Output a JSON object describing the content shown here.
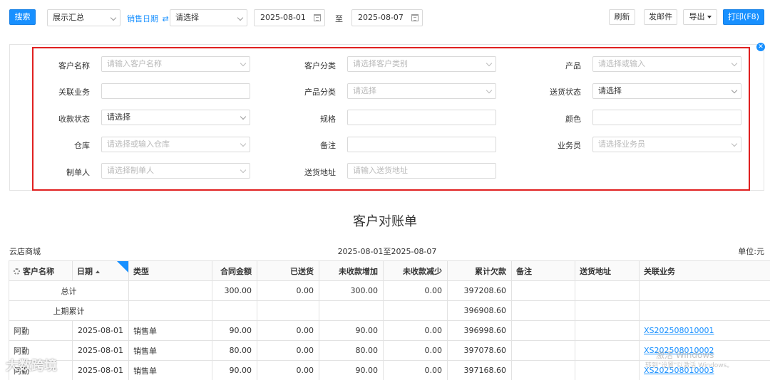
{
  "toolbar": {
    "search_label": "搜索",
    "summary_select": "展示汇总",
    "date_type_label": "销售日期",
    "date_type_select": "请选择",
    "date_start": "2025-08-01",
    "date_to_label": "至",
    "date_end": "2025-08-07",
    "refresh_label": "刷新",
    "email_label": "发邮件",
    "export_label": "导出",
    "print_label": "打印(F8)"
  },
  "filters": {
    "customer_name": {
      "label": "客户名称",
      "placeholder": "请输入客户名称"
    },
    "customer_category": {
      "label": "客户分类",
      "placeholder": "请选择客户类别"
    },
    "product": {
      "label": "产品",
      "placeholder": "请选择或输入"
    },
    "related_business": {
      "label": "关联业务",
      "value": ""
    },
    "product_category": {
      "label": "产品分类",
      "placeholder": "请选择"
    },
    "delivery_status": {
      "label": "送货状态",
      "value": "请选择"
    },
    "payment_status": {
      "label": "收款状态",
      "value": "请选择"
    },
    "spec": {
      "label": "规格",
      "value": ""
    },
    "color": {
      "label": "颜色",
      "value": ""
    },
    "warehouse": {
      "label": "仓库",
      "placeholder": "请选择或输入仓库"
    },
    "remark": {
      "label": "备注",
      "value": ""
    },
    "salesperson": {
      "label": "业务员",
      "placeholder": "请选择业务员"
    },
    "creator": {
      "label": "制单人",
      "placeholder": "请选择制单人"
    },
    "delivery_address": {
      "label": "送货地址",
      "placeholder": "请输入送货地址"
    }
  },
  "report": {
    "title": "客户对账单",
    "company": "云店商城",
    "period": "2025-08-01至2025-08-07",
    "unit": "单位:元",
    "headers": [
      "客户名称",
      "日期",
      "类型",
      "合同金额",
      "已送货",
      "未收款增加",
      "未收款减少",
      "累计欠款",
      "备注",
      "送货地址",
      "关联业务"
    ],
    "total_row": {
      "label": "总计",
      "contract": "300.00",
      "delivered": "0.00",
      "increase": "300.00",
      "decrease": "0.00",
      "balance": "397208.60"
    },
    "prior_row": {
      "label": "上期累计",
      "balance": "396908.60"
    },
    "rows": [
      {
        "customer": "阿勤",
        "date": "2025-08-01",
        "type": "销售单",
        "contract": "90.00",
        "delivered": "0.00",
        "increase": "90.00",
        "decrease": "0.00",
        "balance": "396998.60",
        "remark": "",
        "address": "",
        "business": "XS202508010001"
      },
      {
        "customer": "阿勤",
        "date": "2025-08-01",
        "type": "销售单",
        "contract": "80.00",
        "delivered": "0.00",
        "increase": "80.00",
        "decrease": "0.00",
        "balance": "397078.60",
        "remark": "",
        "address": "",
        "business": "XS202508010002"
      },
      {
        "customer": "阿勤",
        "date": "2025-08-01",
        "type": "销售单",
        "contract": "90.00",
        "delivered": "0.00",
        "increase": "90.00",
        "decrease": "0.00",
        "balance": "397168.60",
        "remark": "",
        "address": "",
        "business": "XS202508010003"
      }
    ]
  },
  "watermark": {
    "logo_text": "大数跨境",
    "win_line1": "激活 Windows",
    "win_line2": "转到\"设置\"以激活 Windows。"
  },
  "colors": {
    "accent": "#1890ff",
    "highlight_border": "#e02020"
  }
}
